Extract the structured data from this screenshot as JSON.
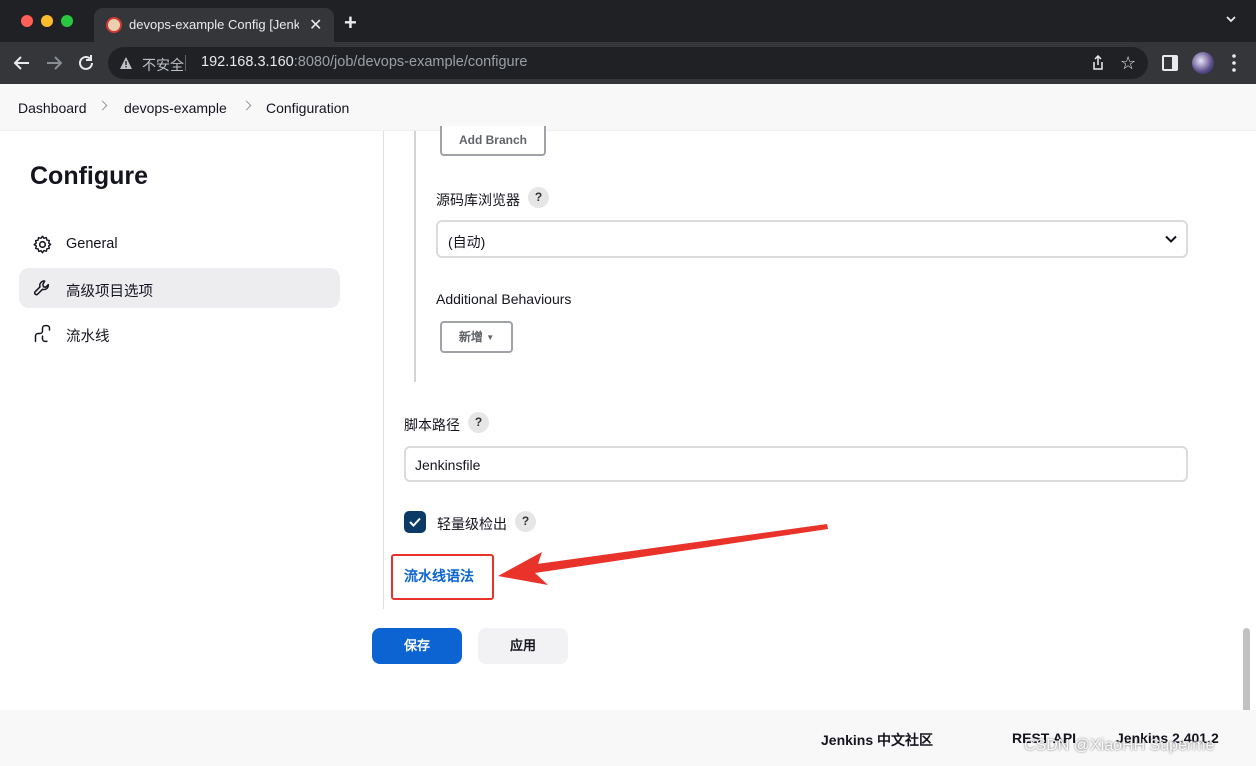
{
  "browser": {
    "tab_title": "devops-example Config [Jenkins]",
    "insecure_label": "不安全",
    "url_host": "192.168.3.160",
    "url_path": ":8080/job/devops-example/configure"
  },
  "breadcrumbs": [
    "Dashboard",
    "devops-example",
    "Configuration"
  ],
  "sidebar": {
    "title": "Configure",
    "items": [
      {
        "label": "General",
        "icon": "gear-icon",
        "active": false
      },
      {
        "label": "高级项目选项",
        "icon": "wrench-icon",
        "active": true
      },
      {
        "label": "流水线",
        "icon": "pipeline-icon",
        "active": false
      }
    ]
  },
  "form": {
    "add_branch_label": "Add Branch",
    "repo_browser_label": "源码库浏览器",
    "repo_browser_value": "(自动)",
    "additional_behaviours_label": "Additional Behaviours",
    "add_behaviour_label": "新增",
    "script_path_label": "脚本路径",
    "script_path_value": "Jenkinsfile",
    "lightweight_checkout_label": "轻量级检出",
    "lightweight_checkout_checked": true,
    "help_symbol": "?",
    "pipeline_syntax_link": "流水线语法"
  },
  "actions": {
    "save_label": "保存",
    "apply_label": "应用"
  },
  "footer": {
    "community": "Jenkins 中文社区",
    "rest_api": "REST API",
    "version": "Jenkins 2.401.2"
  },
  "watermark": "CSDN @XiaoHH Superme",
  "colors": {
    "primary": "#0b64d1",
    "annotation_red": "#e8322a",
    "checkbox": "#0b3a66"
  }
}
